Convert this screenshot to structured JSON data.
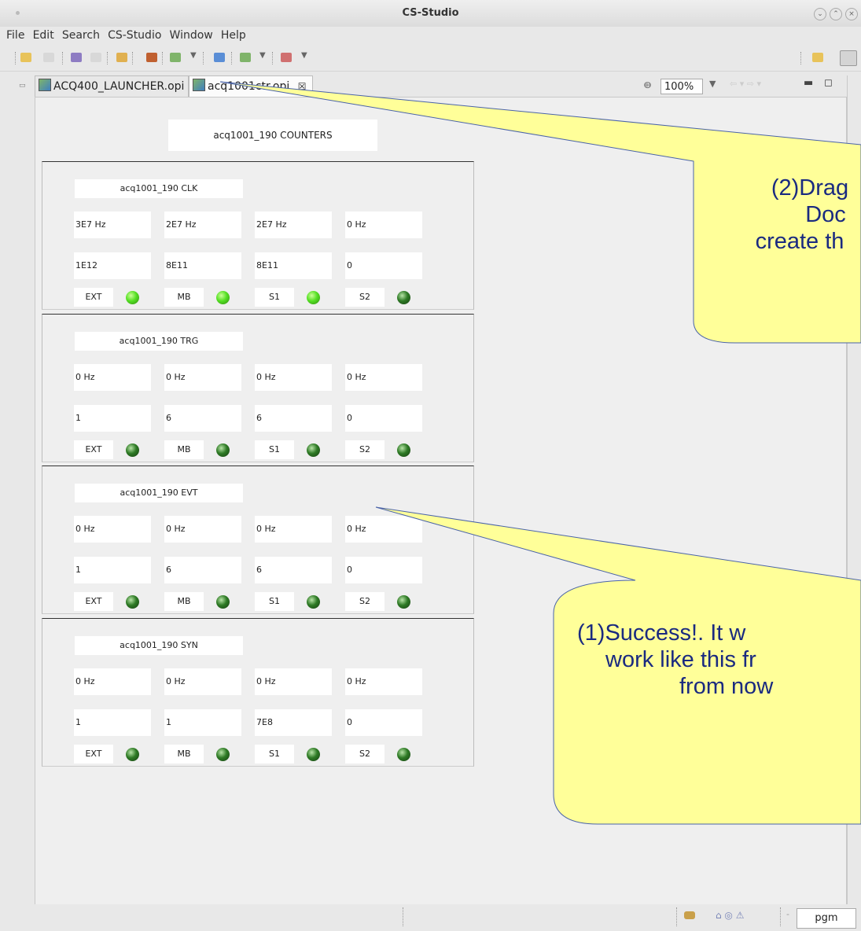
{
  "window": {
    "title": "CS-Studio"
  },
  "menu": [
    "File",
    "Edit",
    "Search",
    "CS-Studio",
    "Window",
    "Help"
  ],
  "tabs": [
    {
      "label": "ACQ400_LAUNCHER.opi",
      "active": false
    },
    {
      "label": "acq1001ctr.opi",
      "active": true,
      "close": "☒"
    }
  ],
  "zoom": {
    "value": "100%"
  },
  "display": {
    "title": "acq1001_190 COUNTERS",
    "sections": [
      {
        "title": "acq1001_190 CLK",
        "freq": [
          "3E7 Hz",
          "2E7 Hz",
          "2E7 Hz",
          "0 Hz"
        ],
        "counts": [
          "1E12",
          "8E11",
          "8E11",
          "0"
        ],
        "leds": [
          {
            "label": "EXT",
            "state": "on"
          },
          {
            "label": "MB",
            "state": "on"
          },
          {
            "label": "S1",
            "state": "on"
          },
          {
            "label": "S2",
            "state": "off"
          }
        ]
      },
      {
        "title": "acq1001_190 TRG",
        "freq": [
          "0 Hz",
          "0 Hz",
          "0 Hz",
          "0 Hz"
        ],
        "counts": [
          "1",
          "6",
          "6",
          "0"
        ],
        "leds": [
          {
            "label": "EXT",
            "state": "off"
          },
          {
            "label": "MB",
            "state": "off"
          },
          {
            "label": "S1",
            "state": "off"
          },
          {
            "label": "S2",
            "state": "off"
          }
        ]
      },
      {
        "title": "acq1001_190 EVT",
        "freq": [
          "0 Hz",
          "0 Hz",
          "0 Hz",
          "0 Hz"
        ],
        "counts": [
          "1",
          "6",
          "6",
          "0"
        ],
        "leds": [
          {
            "label": "EXT",
            "state": "off"
          },
          {
            "label": "MB",
            "state": "off"
          },
          {
            "label": "S1",
            "state": "off"
          },
          {
            "label": "S2",
            "state": "off"
          }
        ]
      },
      {
        "title": "acq1001_190 SYN",
        "freq": [
          "0 Hz",
          "0 Hz",
          "0 Hz",
          "0 Hz"
        ],
        "counts": [
          "1",
          "1",
          "7E8",
          "0"
        ],
        "leds": [
          {
            "label": "EXT",
            "state": "off"
          },
          {
            "label": "MB",
            "state": "off"
          },
          {
            "label": "S1",
            "state": "off"
          },
          {
            "label": "S2",
            "state": "off"
          }
        ]
      }
    ]
  },
  "callouts": [
    {
      "lines": [
        "(2)Drag",
        "Doc",
        "create th"
      ]
    },
    {
      "lines": [
        "(1)Success!. It w",
        "work like this fr",
        "from now"
      ]
    }
  ],
  "statusbar": {
    "perspective": "pgm"
  },
  "colors": {
    "led_on": "#55e024",
    "led_off": "#2e7a25",
    "callout_fill": "#ffff99",
    "callout_text": "#1a2a80"
  }
}
